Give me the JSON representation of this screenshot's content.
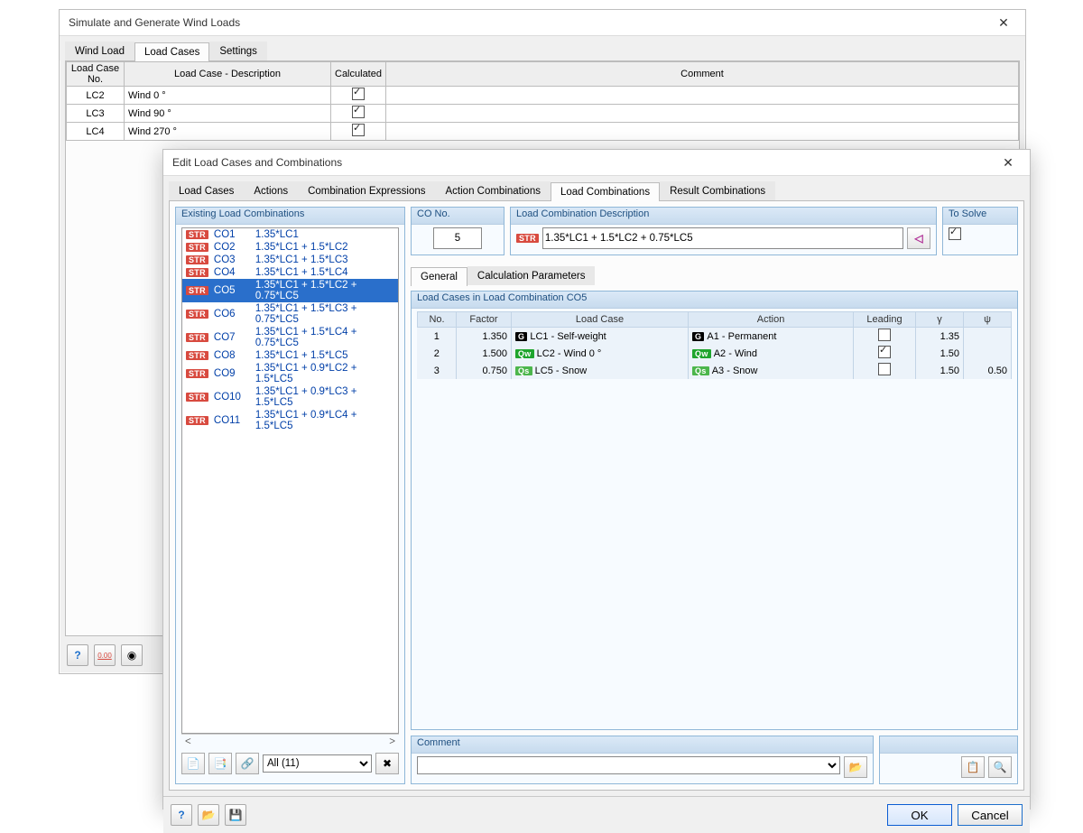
{
  "back": {
    "title": "Simulate and Generate Wind Loads",
    "tabs": [
      "Wind Load",
      "Load Cases",
      "Settings"
    ],
    "activeTab": 1,
    "cols": [
      "Load Case\nNo.",
      "Load Case - Description",
      "Calculated",
      "Comment"
    ],
    "rows": [
      {
        "no": "LC2",
        "desc": "Wind 0 °",
        "calc": true,
        "comment": ""
      },
      {
        "no": "LC3",
        "desc": "Wind 90 °",
        "calc": true,
        "comment": ""
      },
      {
        "no": "LC4",
        "desc": "Wind 270 °",
        "calc": true,
        "comment": ""
      }
    ]
  },
  "front": {
    "title": "Edit Load Cases and Combinations",
    "tabs": [
      "Load Cases",
      "Actions",
      "Combination Expressions",
      "Action Combinations",
      "Load Combinations",
      "Result Combinations"
    ],
    "activeTab": 4,
    "listHeader": "Existing Load Combinations",
    "list": [
      {
        "badge": "STR",
        "co": "CO1",
        "expr": "1.35*LC1"
      },
      {
        "badge": "STR",
        "co": "CO2",
        "expr": "1.35*LC1 + 1.5*LC2"
      },
      {
        "badge": "STR",
        "co": "CO3",
        "expr": "1.35*LC1 + 1.5*LC3"
      },
      {
        "badge": "STR",
        "co": "CO4",
        "expr": "1.35*LC1 + 1.5*LC4"
      },
      {
        "badge": "STR",
        "co": "CO5",
        "expr": "1.35*LC1 + 1.5*LC2 + 0.75*LC5"
      },
      {
        "badge": "STR",
        "co": "CO6",
        "expr": "1.35*LC1 + 1.5*LC3 + 0.75*LC5"
      },
      {
        "badge": "STR",
        "co": "CO7",
        "expr": "1.35*LC1 + 1.5*LC4 + 0.75*LC5"
      },
      {
        "badge": "STR",
        "co": "CO8",
        "expr": "1.35*LC1 + 1.5*LC5"
      },
      {
        "badge": "STR",
        "co": "CO9",
        "expr": "1.35*LC1 + 0.9*LC2 + 1.5*LC5"
      },
      {
        "badge": "STR",
        "co": "CO10",
        "expr": "1.35*LC1 + 0.9*LC3 + 1.5*LC5"
      },
      {
        "badge": "STR",
        "co": "CO11",
        "expr": "1.35*LC1 + 0.9*LC4 + 1.5*LC5"
      }
    ],
    "selectedIndex": 4,
    "filterAll": "All (11)",
    "coNoLabel": "CO No.",
    "coNo": "5",
    "descLabel": "Load Combination Description",
    "descBadge": "STR",
    "desc": "1.35*LC1 + 1.5*LC2 + 0.75*LC5",
    "toSolveLabel": "To Solve",
    "toSolve": true,
    "subtabs": [
      "General",
      "Calculation Parameters"
    ],
    "subtabActive": 0,
    "casesHeader": "Load Cases in Load Combination CO5",
    "casesCols": [
      "No.",
      "Factor",
      "Load Case",
      "Action",
      "Leading",
      "γ",
      "ψ"
    ],
    "cases": [
      {
        "no": 1,
        "factor": "1.350",
        "lb": "G",
        "lc": "LC1 - Self-weight",
        "ab": "G",
        "act": "A1 - Permanent",
        "lead": false,
        "g": "1.35",
        "psi": ""
      },
      {
        "no": 2,
        "factor": "1.500",
        "lb": "Qw",
        "lc": "LC2 - Wind 0 °",
        "ab": "Qw",
        "act": "A2 - Wind",
        "lead": true,
        "g": "1.50",
        "psi": ""
      },
      {
        "no": 3,
        "factor": "0.750",
        "lb": "Qs",
        "lc": "LC5 - Snow",
        "ab": "Qs",
        "act": "A3 - Snow",
        "lead": false,
        "g": "1.50",
        "psi": "0.50"
      }
    ],
    "commentLabel": "Comment",
    "comment": "",
    "buttons": {
      "ok": "OK",
      "cancel": "Cancel"
    }
  }
}
